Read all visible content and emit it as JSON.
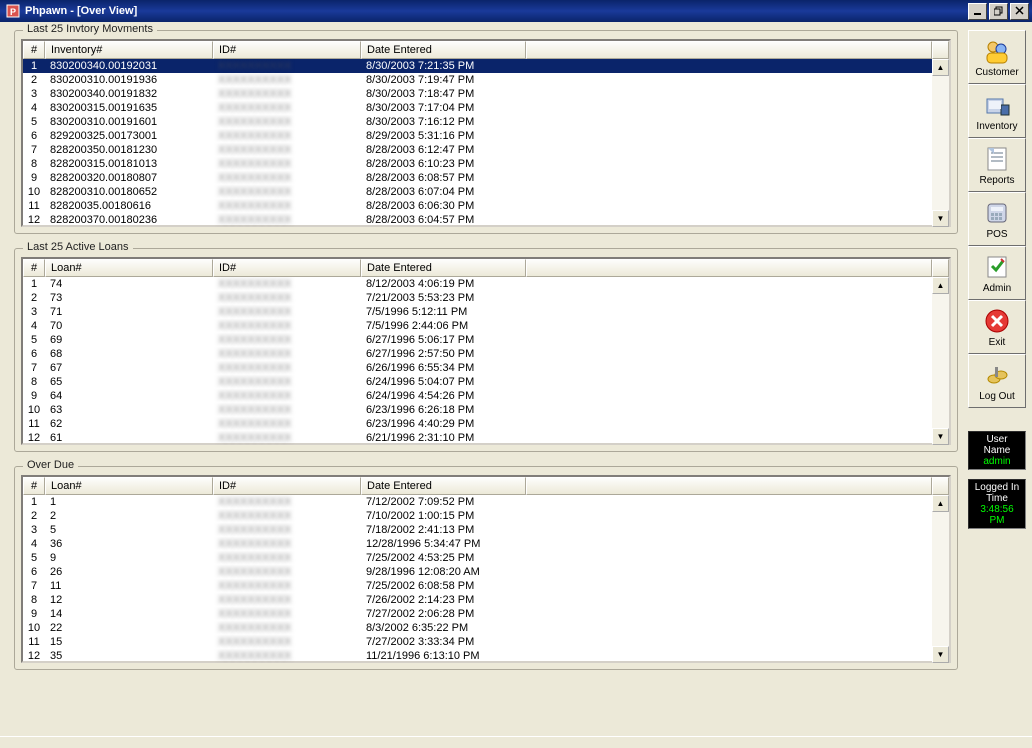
{
  "title": "Phpawn - [Over View]",
  "groups": {
    "inventory": {
      "legend": "Last 25 Invtory Movments",
      "headers": [
        "#",
        "Inventory#",
        "ID#",
        "Date Entered"
      ],
      "rows": [
        {
          "n": "1",
          "inv": "830200340.00192031",
          "id": "",
          "date": "8/30/2003 7:21:35 PM",
          "selected": true
        },
        {
          "n": "2",
          "inv": "830200310.00191936",
          "id": "",
          "date": "8/30/2003 7:19:47 PM"
        },
        {
          "n": "3",
          "inv": "830200340.00191832",
          "id": "",
          "date": "8/30/2003 7:18:47 PM"
        },
        {
          "n": "4",
          "inv": "830200315.00191635",
          "id": "",
          "date": "8/30/2003 7:17:04 PM"
        },
        {
          "n": "5",
          "inv": "830200310.00191601",
          "id": "",
          "date": "8/30/2003 7:16:12 PM"
        },
        {
          "n": "6",
          "inv": "829200325.00173001",
          "id": "",
          "date": "8/29/2003 5:31:16 PM"
        },
        {
          "n": "7",
          "inv": "828200350.00181230",
          "id": "",
          "date": "8/28/2003 6:12:47 PM"
        },
        {
          "n": "8",
          "inv": "828200315.00181013",
          "id": "",
          "date": "8/28/2003 6:10:23 PM"
        },
        {
          "n": "9",
          "inv": "828200320.00180807",
          "id": "",
          "date": "8/28/2003 6:08:57 PM"
        },
        {
          "n": "10",
          "inv": "828200310.00180652",
          "id": "",
          "date": "8/28/2003 6:07:04 PM"
        },
        {
          "n": "11",
          "inv": "82820035.00180616",
          "id": "",
          "date": "8/28/2003 6:06:30 PM"
        },
        {
          "n": "12",
          "inv": "828200370.00180236",
          "id": "",
          "date": "8/28/2003 6:04:57 PM"
        }
      ]
    },
    "loans": {
      "legend": "Last 25 Active Loans",
      "headers": [
        "#",
        "Loan#",
        "ID#",
        "Date Entered"
      ],
      "rows": [
        {
          "n": "1",
          "inv": "74",
          "id": "",
          "date": "8/12/2003 4:06:19 PM"
        },
        {
          "n": "2",
          "inv": "73",
          "id": "",
          "date": "7/21/2003 5:53:23 PM"
        },
        {
          "n": "3",
          "inv": "71",
          "id": "",
          "date": "7/5/1996 5:12:11 PM"
        },
        {
          "n": "4",
          "inv": "70",
          "id": "",
          "date": "7/5/1996 2:44:06 PM"
        },
        {
          "n": "5",
          "inv": "69",
          "id": "",
          "date": "6/27/1996 5:06:17 PM"
        },
        {
          "n": "6",
          "inv": "68",
          "id": "",
          "date": "6/27/1996 2:57:50 PM"
        },
        {
          "n": "7",
          "inv": "67",
          "id": "",
          "date": "6/26/1996 6:55:34 PM"
        },
        {
          "n": "8",
          "inv": "65",
          "id": "",
          "date": "6/24/1996 5:04:07 PM"
        },
        {
          "n": "9",
          "inv": "64",
          "id": "",
          "date": "6/24/1996 4:54:26 PM"
        },
        {
          "n": "10",
          "inv": "63",
          "id": "",
          "date": "6/23/1996 6:26:18 PM"
        },
        {
          "n": "11",
          "inv": "62",
          "id": "",
          "date": "6/23/1996 4:40:29 PM"
        },
        {
          "n": "12",
          "inv": "61",
          "id": "",
          "date": "6/21/1996 2:31:10 PM"
        }
      ]
    },
    "overdue": {
      "legend": "Over Due",
      "headers": [
        "#",
        "Loan#",
        "ID#",
        "Date Entered"
      ],
      "rows": [
        {
          "n": "1",
          "inv": "1",
          "id": "",
          "date": "7/12/2002 7:09:52 PM"
        },
        {
          "n": "2",
          "inv": "2",
          "id": "",
          "date": "7/10/2002 1:00:15 PM"
        },
        {
          "n": "3",
          "inv": "5",
          "id": "",
          "date": "7/18/2002 2:41:13 PM"
        },
        {
          "n": "4",
          "inv": "36",
          "id": "",
          "date": "12/28/1996 5:34:47 PM"
        },
        {
          "n": "5",
          "inv": "9",
          "id": "",
          "date": "7/25/2002 4:53:25 PM"
        },
        {
          "n": "6",
          "inv": "26",
          "id": "",
          "date": "9/28/1996 12:08:20 AM"
        },
        {
          "n": "7",
          "inv": "11",
          "id": "",
          "date": "7/25/2002 6:08:58 PM"
        },
        {
          "n": "8",
          "inv": "12",
          "id": "",
          "date": "7/26/2002 2:14:23 PM"
        },
        {
          "n": "9",
          "inv": "14",
          "id": "",
          "date": "7/27/2002 2:06:28 PM"
        },
        {
          "n": "10",
          "inv": "22",
          "id": "",
          "date": "8/3/2002 6:35:22 PM"
        },
        {
          "n": "11",
          "inv": "15",
          "id": "",
          "date": "7/27/2002 3:33:34 PM"
        },
        {
          "n": "12",
          "inv": "35",
          "id": "",
          "date": "11/21/1996 6:13:10 PM"
        }
      ]
    }
  },
  "sidebar": [
    {
      "label": "Customer",
      "icon": "customer"
    },
    {
      "label": "Inventory",
      "icon": "inventory"
    },
    {
      "label": "Reports",
      "icon": "reports"
    },
    {
      "label": "POS",
      "icon": "pos"
    },
    {
      "label": "Admin",
      "icon": "admin"
    },
    {
      "label": "Exit",
      "icon": "exit"
    },
    {
      "label": "Log Out",
      "icon": "logout"
    }
  ],
  "status": {
    "user_label": "User Name",
    "user_value": "admin",
    "time_label": "Logged In Time",
    "time_value": "3:48:56 PM"
  }
}
